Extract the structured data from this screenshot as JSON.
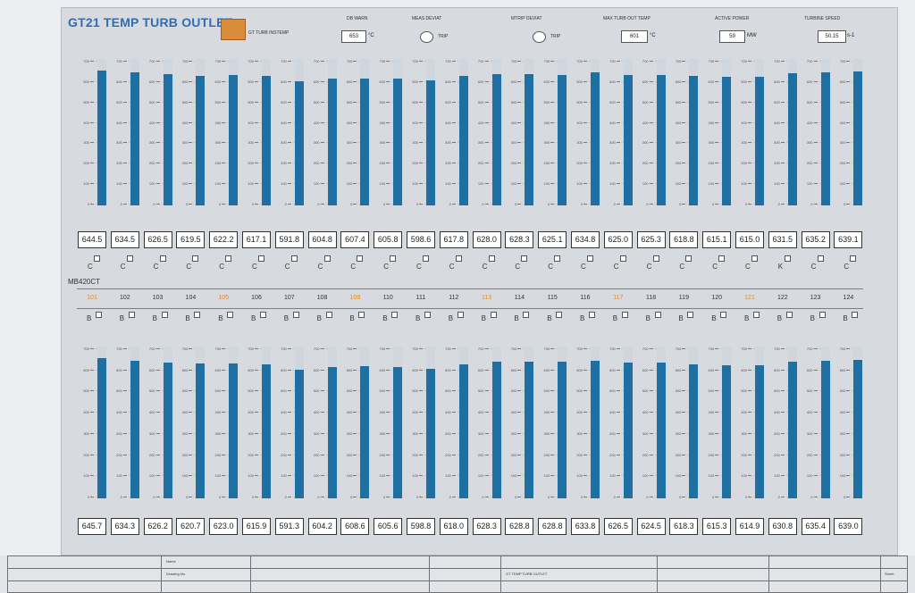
{
  "title": "GT21 TEMP TURB OUTLET",
  "header": {
    "button_label": "GT TURB INSTEMP",
    "fields": [
      {
        "label": "DB WARN",
        "value": "653",
        "unit": "°C"
      },
      {
        "label": "MEAS DEVIAT",
        "value": "TRIP"
      },
      {
        "label": "MTRIP DEVIAT",
        "value": "TRIP"
      },
      {
        "label": "MAX TURB OUT TEMP",
        "value": "601",
        "unit": "°C"
      },
      {
        "label": "ACTIVE POWER",
        "value": "59",
        "unit": "MW"
      },
      {
        "label": "TURBINE SPEED",
        "value": "50.15",
        "unit": "s-1"
      }
    ]
  },
  "scale_ticks": [
    "700",
    "600",
    "500",
    "400",
    "300",
    "200",
    "100",
    "0"
  ],
  "top_bars": {
    "values": [
      644.5,
      634.5,
      626.5,
      619.5,
      622.2,
      617.1,
      591.8,
      604.8,
      607.4,
      605.8,
      598.6,
      617.8,
      628.0,
      628.3,
      625.1,
      634.8,
      625.0,
      625.3,
      618.8,
      615.1,
      615.0,
      631.5,
      635.2,
      639.1
    ],
    "labels": [
      "644.5",
      "634.5",
      "626.5",
      "619.5",
      "622.2",
      "617.1",
      "591.8",
      "604.8",
      "607.4",
      "605.8",
      "598.6",
      "617.8",
      "628.0",
      "628.3",
      "625.1",
      "634.8",
      "625.0",
      "625.3",
      "618.8",
      "615.1",
      "615.0",
      "631.5",
      "635.2",
      "639.1"
    ],
    "marks": [
      "C",
      "C",
      "C",
      "C",
      "C",
      "C",
      "C",
      "C",
      "C",
      "C",
      "C",
      "C",
      "C",
      "C",
      "C",
      "C",
      "C",
      "C",
      "C",
      "C",
      "C",
      "K",
      "C",
      "C"
    ]
  },
  "section_label": "MB420CT",
  "channel_numbers": [
    "101",
    "102",
    "103",
    "104",
    "105",
    "106",
    "107",
    "108",
    "109",
    "110",
    "111",
    "112",
    "113",
    "114",
    "115",
    "116",
    "117",
    "118",
    "119",
    "120",
    "121",
    "122",
    "123",
    "124"
  ],
  "orange_channels": [
    "101",
    "105",
    "109",
    "113",
    "117",
    "121"
  ],
  "bottom_marks": [
    "B",
    "B",
    "B",
    "B",
    "B",
    "B",
    "B",
    "B",
    "B",
    "B",
    "B",
    "B",
    "B",
    "B",
    "B",
    "B",
    "B",
    "B",
    "B",
    "B",
    "B",
    "B",
    "B",
    "B"
  ],
  "bottom_bars": {
    "values": [
      645.7,
      634.3,
      626.2,
      620.7,
      623.0,
      615.9,
      591.3,
      604.2,
      608.6,
      605.6,
      598.8,
      618.0,
      628.3,
      628.8,
      628.8,
      633.8,
      626.5,
      624.5,
      618.3,
      615.3,
      614.9,
      630.8,
      635.4,
      639.0
    ],
    "labels": [
      "645.7",
      "634.3",
      "626.2",
      "620.7",
      "623.0",
      "615.9",
      "591.3",
      "604.2",
      "608.6",
      "605.6",
      "598.8",
      "618.0",
      "628.3",
      "628.8",
      "628.8",
      "633.8",
      "626.5",
      "624.5",
      "618.3",
      "615.3",
      "614.9",
      "630.8",
      "635.4",
      "639.0"
    ]
  },
  "scale_max": 700,
  "colors": {
    "bar": "#1e6fa4",
    "title": "#2f6db7",
    "orange": "#e08b2c"
  },
  "title_block": {
    "cells": [
      {
        "text": "Name"
      },
      {
        "text": "Drawing No."
      },
      {
        "text": "GT TEMP TURB OUTLET"
      },
      {
        "text": "Sheet"
      }
    ]
  }
}
